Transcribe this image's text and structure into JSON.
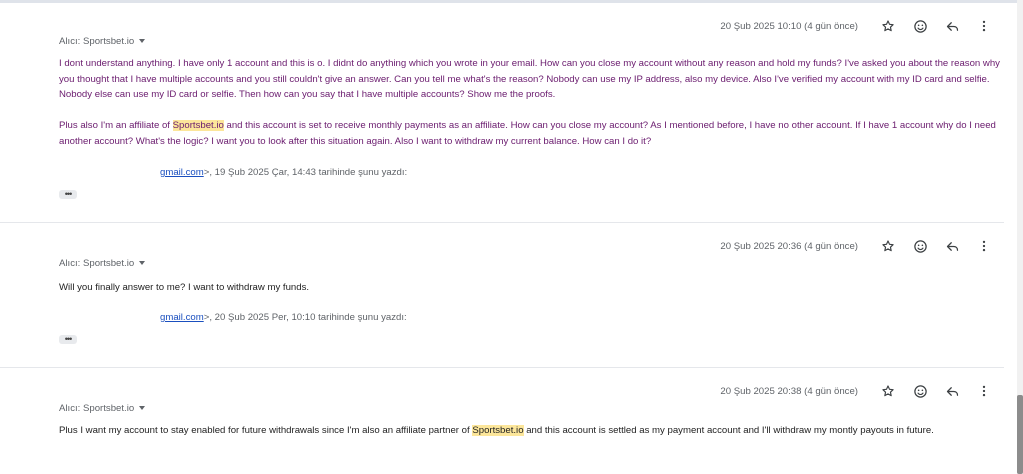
{
  "messages": [
    {
      "date": "20 Şub 2025 10:10 (4 gün önce)",
      "recipient": "Alıcı: Sportsbet.io",
      "p1": "I dont understand anything. I have only 1 account and this is o. I didnt do anything which you wrote in your email. How can you close my account without any reason and hold my funds? I've asked you about the reason why you thought that I have multiple accounts and you still couldn't give an answer. Can you tell me what's the reason? Nobody can use my IP address, also my device. Also I've verified my account with my ID card and selfie. Nobody else can use my ID card or selfie. Then how can you say that I have multiple accounts? Show me the proofs.",
      "p2_before": "Plus also I'm an affiliate of ",
      "highlight": "Sportsbet.io",
      "p2_after": " and this account is set to receive monthly payments as an affiliate. How can you close my account? As I mentioned before, I have no other account. If I have 1 account why do I need another account? What's the logic? I want you to look after this situation again. Also I want to withdraw my current balance. How can I do it?",
      "quote_prefix": "",
      "quote_link": "gmail.com",
      "quote_suffix": ">, 19 Şub 2025 Çar, 14:43 tarihinde şunu yazdı:",
      "dots": "•••"
    },
    {
      "date": "20 Şub 2025 20:36 (4 gün önce)",
      "recipient": "Alıcı: Sportsbet.io",
      "text": "Will you finally answer to me? I want to withdraw my funds.",
      "quote_prefix": "",
      "quote_link": "gmail.com",
      "quote_suffix": ">, 20 Şub 2025 Per, 10:10 tarihinde şunu yazdı:",
      "dots": "•••"
    },
    {
      "date": "20 Şub 2025 20:38 (4 gün önce)",
      "recipient": "Alıcı: Sportsbet.io",
      "before": "Plus I want my account to stay enabled for future withdrawals since I'm also an affiliate partner of ",
      "highlight": "Sportsbet.io",
      "after": " and this account is settled as my payment account and I'll withdraw my montly payouts in future."
    }
  ],
  "icons": [
    "star-icon",
    "emoji-icon",
    "reply-icon",
    "more-vert-icon"
  ],
  "colors": {
    "body_purple": "#6a1b6e",
    "highlight": "#fce69a",
    "link": "#1a4fbf",
    "meta": "#5f6368"
  }
}
